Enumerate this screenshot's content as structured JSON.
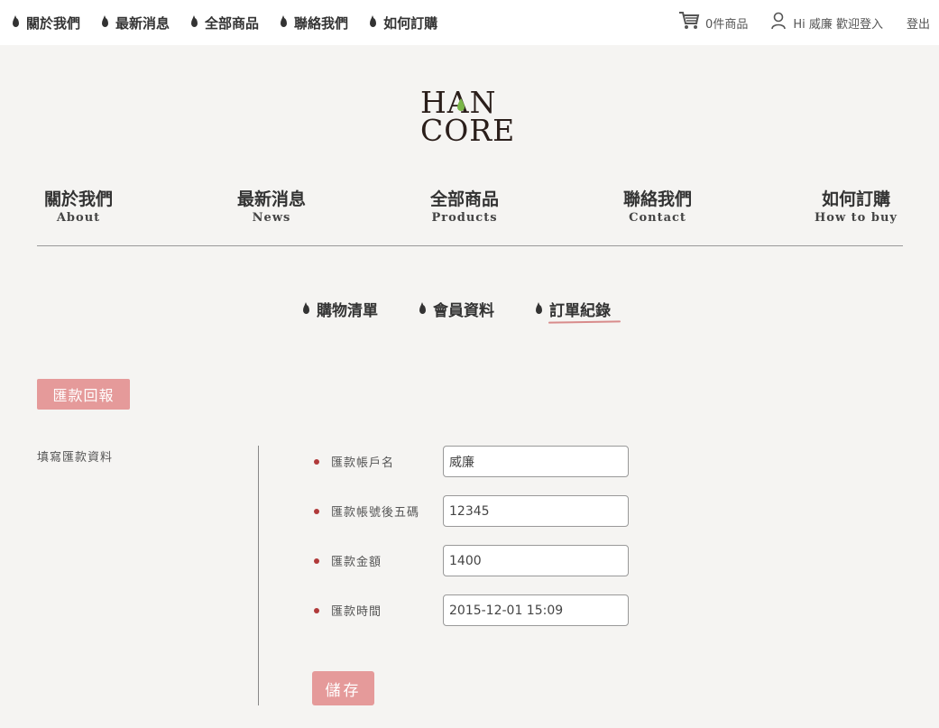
{
  "topnav": [
    {
      "label": "關於我們"
    },
    {
      "label": "最新消息"
    },
    {
      "label": "全部商品"
    },
    {
      "label": "聯絡我們"
    },
    {
      "label": "如何訂購"
    }
  ],
  "header": {
    "cart_label": "0件商品",
    "user_greeting": "Hi 威廉 歡迎登入",
    "logout_label": "登出"
  },
  "logo": {
    "line1": "HAN",
    "line2": "CORE",
    "accent_color": "#7ab648"
  },
  "mainnav": [
    {
      "zh": "關於我們",
      "en": "About"
    },
    {
      "zh": "最新消息",
      "en": "News"
    },
    {
      "zh": "全部商品",
      "en": "Products"
    },
    {
      "zh": "聯絡我們",
      "en": "Contact"
    },
    {
      "zh": "如何訂購",
      "en": "How to buy"
    }
  ],
  "subnav": [
    {
      "label": "購物清單"
    },
    {
      "label": "會員資料"
    },
    {
      "label": "訂單紀錄",
      "active": true
    }
  ],
  "section": {
    "tag": "匯款回報",
    "side_label": "填寫匯款資料"
  },
  "form": {
    "fields": [
      {
        "label": "匯款帳戶名",
        "value": "威廉"
      },
      {
        "label": "匯款帳號後五碼",
        "value": "12345"
      },
      {
        "label": "匯款金額",
        "value": "1400"
      },
      {
        "label": "匯款時間",
        "value": "2015-12-01 15:09"
      }
    ],
    "save_label": "儲存"
  },
  "colors": {
    "accent": "#e59a9a",
    "bullet": "#b03a3a",
    "background": "#f5f4f2"
  }
}
